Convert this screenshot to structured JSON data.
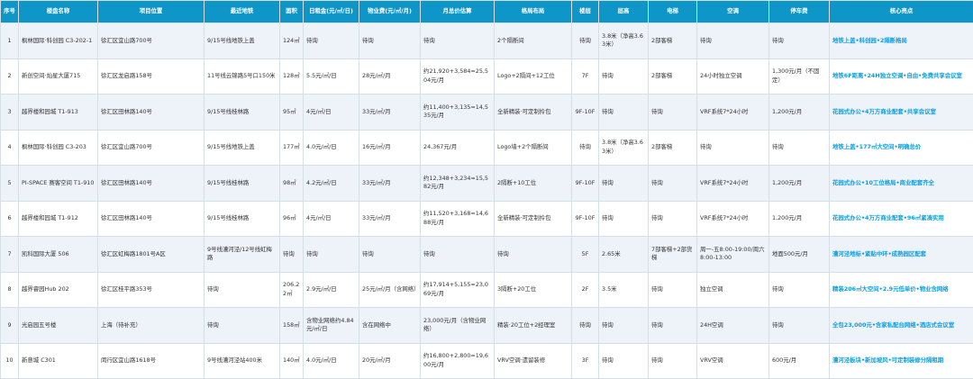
{
  "headers": [
    "序号",
    "楼盘名称",
    "项目位置",
    "最近地铁",
    "面积",
    "日租金(元/㎡/日)",
    "物业费(元/㎡/月)",
    "月总价估算",
    "格局布局",
    "楼层",
    "层高",
    "电梯",
    "空调",
    "停车费",
    "核心亮点"
  ],
  "rows": [
    [
      "1",
      "枫林国际·科创园 C3-202-1",
      "徐汇区宜山路700号",
      "9/15号线地铁上盖",
      "124㎡",
      "待询",
      "待询",
      "待询",
      "2个隔断间",
      "待询",
      "3.8米（净高3.63米）",
      "2部客梯",
      "待询",
      "待询",
      "地铁上盖•科创园•2隔断格局"
    ],
    [
      "2",
      "新创空间·灿星大厦715",
      "徐汇区龙启路158号",
      "11号线云锦路5号口150米",
      "128㎡",
      "5.5元/㎡/日",
      "28元/㎡/月",
      "约21,920+3,584=25,504元/月",
      "Logo+2隔间+12工位",
      "7F",
      "待询",
      "2部客梯",
      "24小时独立空调",
      "1,300元/月（不固定）",
      "地铁6F距离•24H独立空调•自由•免费共享会议室"
    ],
    [
      "3",
      "越界楼和园城 T1-913",
      "徐汇区田林路140号",
      "9/15号线桂林路",
      "95㎡",
      "4元/㎡/日",
      "33元/㎡/月",
      "约11,400+3,135=14,535元/月",
      "全新精装·可定制拎包",
      "9F-10F",
      "待询",
      "待询",
      "VRF系统7*24小时",
      "1,200元/月",
      "花园式办公•4万方商业配套•共享会议室"
    ],
    [
      "4",
      "枫林国际·科创园 C3-203",
      "徐汇区宜山路700号",
      "9/15号线地铁上盖",
      "177㎡",
      "4.0元/㎡/日",
      "16元/㎡/月",
      "24,367元/月",
      "Logo墙+2个隔断间",
      "待询",
      "3.8米（净高3.63米）",
      "2部客梯",
      "待询",
      "待询",
      "地铁上盖•177㎡大空间•明确总价"
    ],
    [
      "5",
      "PI-SPACE 赛客空间 T1-910",
      "徐汇区田林路140号",
      "9/15号线桂林路",
      "98㎡",
      "4.2元/㎡/日",
      "33元/㎡/月",
      "约12,348+3,234=15,582元/月",
      "2隔断+10工位",
      "9F-10F",
      "待询",
      "待询",
      "VRF系统7*24小时",
      "1,200元/月",
      "花园式办公•10工位格局•商业配套齐全"
    ],
    [
      "6",
      "越界楼和园城 T1-912",
      "徐汇区田林路140号",
      "9/15号线桂林路",
      "96㎡",
      "4元/㎡/日",
      "33元/㎡/月",
      "约11,520+3,168=14,688元/月",
      "全新精装·可定制拎包",
      "9F-10F",
      "待询",
      "待询",
      "VRF系统7*24小时",
      "1,200元/月",
      "花园式办公•4万方商业配套•96㎡紧凑实用"
    ],
    [
      "7",
      "凯科国际大厦 506",
      "徐汇区虹梅路1801号A区",
      "9号线漕河泾/12号线虹梅路",
      "待询",
      "待询",
      "待询",
      "待询",
      "待询",
      "5F",
      "2.65米",
      "7部客梯+2部货梯",
      "周一-五8:00-19:00/周六8:00-13:00",
      "地面500元/月",
      "漕河泾地标•紧贴中环•成熟园区配套"
    ],
    [
      "8",
      "越界睿园Hub 202",
      "徐汇区桂平路353号",
      "待询",
      "206.22㎡",
      "2.9元/㎡/日",
      "25元/㎡/月（含网络）",
      "约17,914+5,155=23,069元/月",
      "3隔断+20工位",
      "2F",
      "3.5米",
      "待询",
      "独立空调",
      "待询",
      "精装206㎡大空间•2.9元低单价•物业含网络"
    ],
    [
      "9",
      "光启园五号楼",
      "上海（待补充）",
      "待询",
      "158㎡",
      "含物业网络约4.84元/㎡/日",
      "含在网络中",
      "23,000元/月（含物业网络）",
      "精装·20工位+2经理室",
      "待询",
      "待询",
      "待询",
      "24H空调",
      "待询",
      "全包23,000元•含家私配台网络•酒店式会议室"
    ],
    [
      "10",
      "新意城 C301",
      "闵行区宜山路1618号",
      "9号线漕河泾站400米",
      "140㎡",
      "4.0元/㎡/日",
      "20元/㎡/月",
      "约16,800+2,800=19,600元/月",
      "VRV空调·遗留装修",
      "3F",
      "待询",
      "待询",
      "VRV空调",
      "600元/月",
      "漕河泾板块•新加坡风•可定制装修分隔租期"
    ]
  ]
}
